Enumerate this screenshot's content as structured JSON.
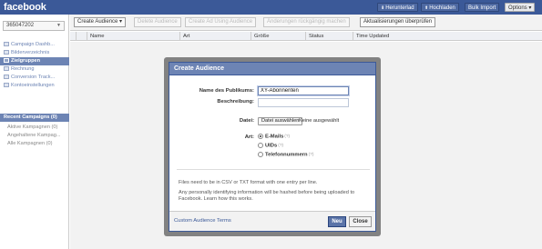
{
  "app": {
    "logo": "facebook",
    "top_actions": [
      {
        "label": "Herunterlad",
        "icon": "download-icon"
      },
      {
        "label": "Hochladen",
        "icon": "upload-icon"
      },
      {
        "label": "Bulk Import"
      },
      {
        "label": "Options"
      }
    ],
    "accent_color": "#3b5998"
  },
  "sidebar": {
    "account": "365047202",
    "items": [
      {
        "label": "Campaign Dashb...",
        "icon": "dashboard-icon"
      },
      {
        "label": "Bilderverzeichnis",
        "icon": "images-icon"
      },
      {
        "label": "Zielgruppen",
        "icon": "audience-icon",
        "active": true
      },
      {
        "label": "Rechnung",
        "icon": "billing-icon"
      },
      {
        "label": "Conversion Track...",
        "icon": "conversion-icon"
      },
      {
        "label": "Kontoeinstellungen",
        "icon": "settings-icon"
      }
    ],
    "section_title": "Recent Campaigns (0)",
    "campaigns": [
      "Aktive Kampagnen (0)",
      "Angehaltene Kampag...",
      "Alle Kampagnen (0)"
    ]
  },
  "toolbar": {
    "create_audience": "Create Audience",
    "delete_audience": "Delete Audience",
    "create_ad": "Create Ad Using Audience",
    "save_changes": "Änderungen rückgängig machen",
    "check_updates": "Aktualisierungen überprüfen"
  },
  "table": {
    "columns": [
      "Name",
      "Art",
      "Größe",
      "Status",
      "Time Updated"
    ]
  },
  "dialog": {
    "title": "Create Audience",
    "name_label": "Name des Publikums:",
    "name_value": "XY-Abonnenten",
    "description_label": "Beschreibung:",
    "description_value": "",
    "file_label": "Datei:",
    "file_button": "Datei auswählen",
    "file_status": "Keine ausgewählt",
    "type_label": "Art:",
    "type_options": [
      {
        "label": "E-Mails",
        "help": "(?)",
        "checked": true
      },
      {
        "label": "UIDs",
        "help": "(?)",
        "checked": false
      },
      {
        "label": "Telefonnummern",
        "help": "(?)",
        "checked": false
      }
    ],
    "note_1": "Files need to be in CSV or TXT format with one entry per line.",
    "note_2": "Any personally identifying information will be hashed before being uploaded to Facebook. Learn how this works.",
    "terms_link": "Custom Audience Terms",
    "btn_new": "Neu",
    "btn_close": "Close"
  }
}
